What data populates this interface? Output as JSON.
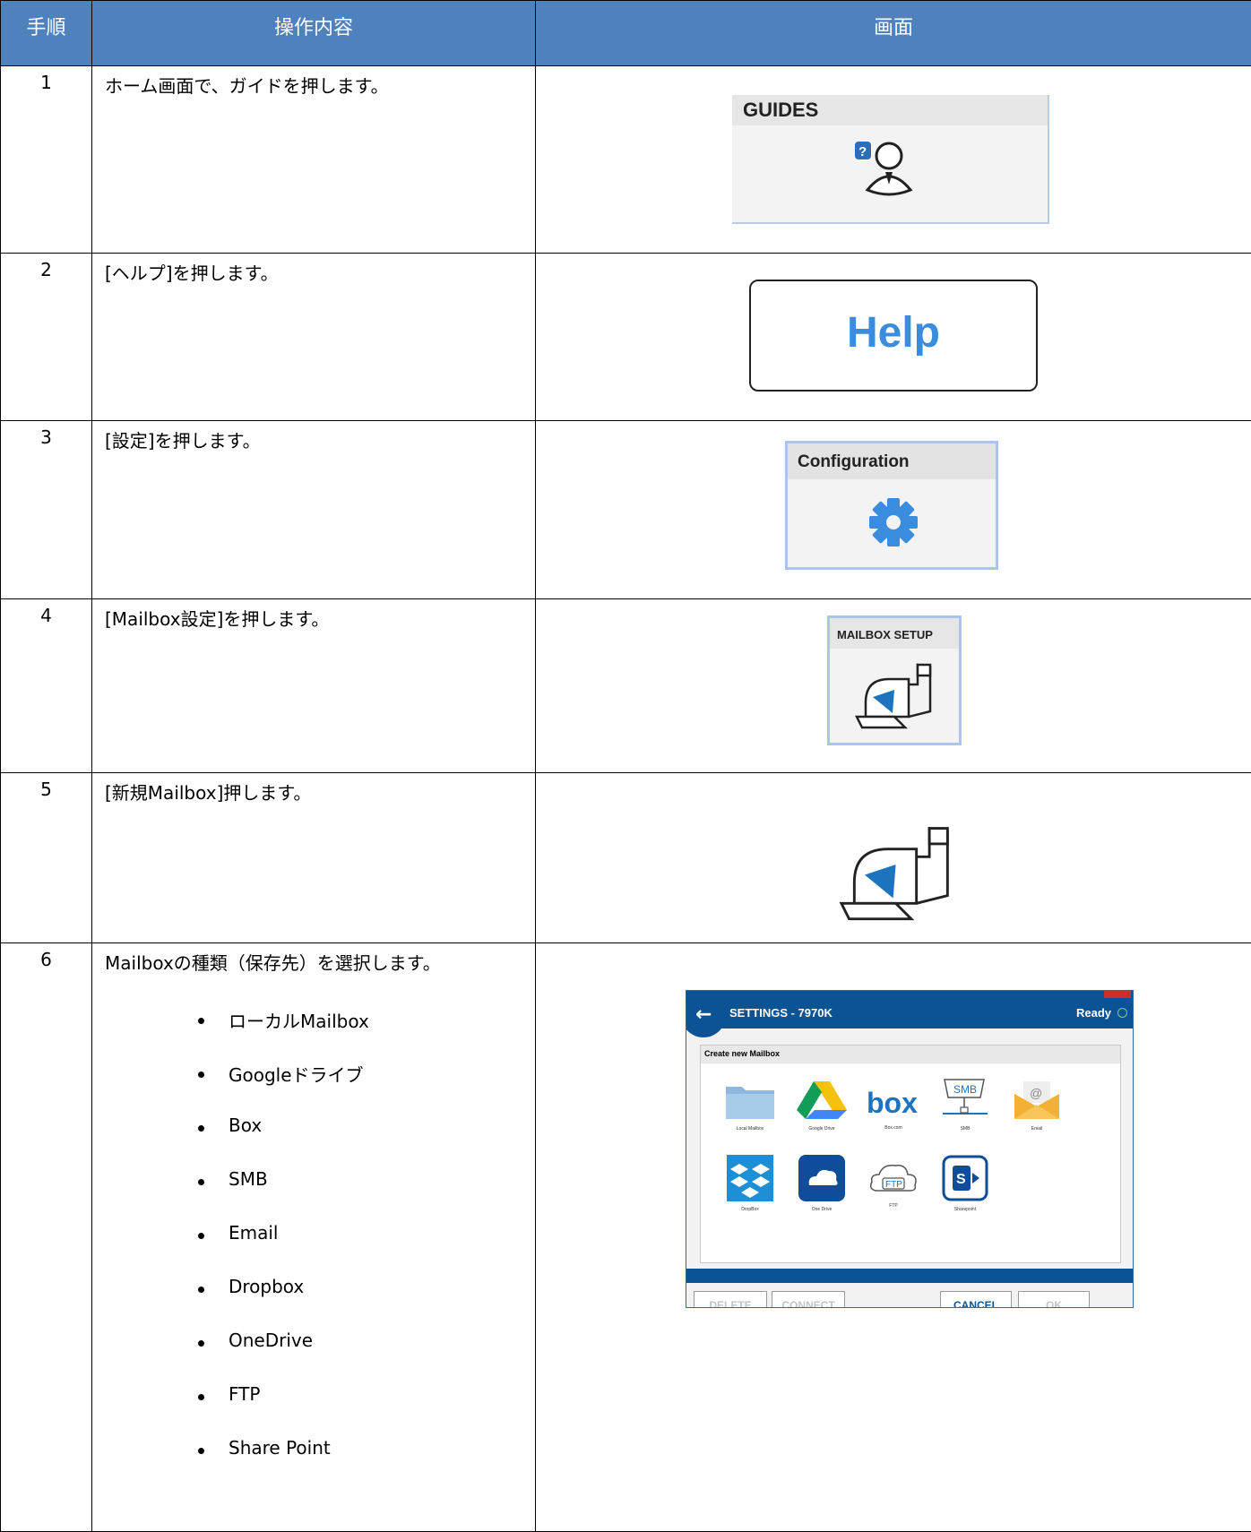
{
  "headers": {
    "step": "手順",
    "operation": "操作内容",
    "screen": "画面"
  },
  "steps": [
    {
      "num": "1",
      "text": "ホーム画面で、ガイドを押します。",
      "screen_label": "GUIDES"
    },
    {
      "num": "2",
      "text": "[ヘルプ]を押します。",
      "screen_label": "Help"
    },
    {
      "num": "3",
      "text": "[設定]を押します。",
      "screen_label": "Configuration"
    },
    {
      "num": "4",
      "text": "[Mailbox設定]を押します。",
      "screen_label": "MAILBOX SETUP"
    },
    {
      "num": "5",
      "text": "[新規Mailbox]押します。"
    },
    {
      "num": "6",
      "text": "Mailboxの種類（保存先）を選択します。",
      "bullets": [
        "ローカルMailbox",
        "Googleドライブ",
        "Box",
        "SMB",
        "Email",
        "Dropbox",
        "OneDrive",
        "FTP",
        "Share Point"
      ]
    }
  ],
  "settings_window": {
    "title": "SETTINGS - 7970K",
    "status": "Ready",
    "panel_title": "Create new Mailbox",
    "tiles": [
      "Local Mailbox",
      "Google Drive",
      "Box.com",
      "SMB",
      "Email",
      "DropBox",
      "One Drive",
      "FTP",
      "Sharepoint"
    ],
    "buttons": {
      "delete": "DELETE",
      "connect": "CONNECT",
      "cancel": "CANCEL",
      "ok": "OK"
    }
  },
  "colors": {
    "header_bg": "#4f81bd",
    "accent": "#0b5394",
    "help_text": "#3a8dde",
    "gear": "#3a8dde"
  }
}
